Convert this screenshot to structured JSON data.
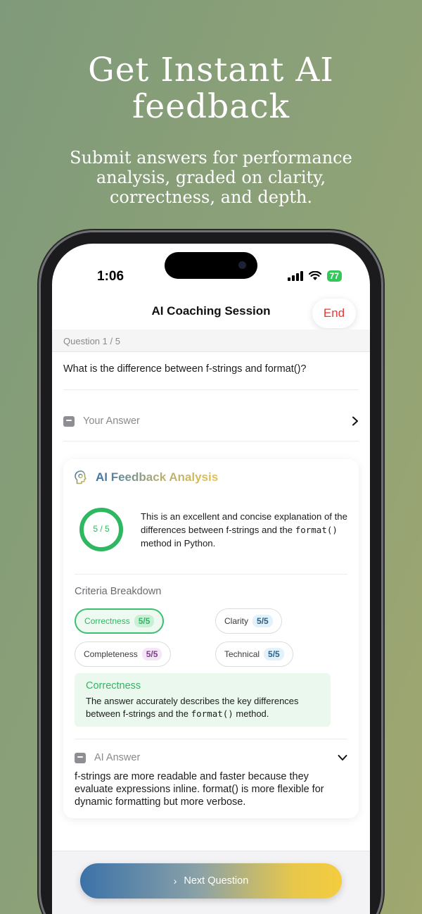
{
  "hero": {
    "title_line1": "Get Instant AI",
    "title_line2": "feedback",
    "subtitle": "Submit answers for performance analysis, graded on clarity, correctness, and depth."
  },
  "status_bar": {
    "time": "1:06",
    "battery": "77"
  },
  "header": {
    "title": "AI Coaching Session",
    "end_label": "End"
  },
  "progress": {
    "label": "Question 1 / 5",
    "current": 1,
    "total": 5
  },
  "question": {
    "text": "What is the difference between f-strings and format()?"
  },
  "your_answer": {
    "label": "Your Answer"
  },
  "feedback": {
    "title": "AI Feedback Analysis",
    "score_label": "5 / 5",
    "score": 5,
    "score_max": 5,
    "summary_pre": "This is an excellent and concise explanation of the differences between f-strings and the ",
    "summary_code": "format()",
    "summary_post": " method in Python.",
    "criteria_label": "Criteria Breakdown",
    "criteria": [
      {
        "name": "Correctness",
        "score": "5/5"
      },
      {
        "name": "Clarity",
        "score": "5/5"
      },
      {
        "name": "Completeness",
        "score": "5/5"
      },
      {
        "name": "Technical",
        "score": "5/5"
      }
    ],
    "detail": {
      "title": "Correctness",
      "text_pre": "The answer accurately describes the key differences between f-strings and the ",
      "text_code": "format()",
      "text_post": " method."
    },
    "ai_answer_label": "AI Answer",
    "ai_answer_text": "f-strings are more readable and faster because they evaluate expressions inline. format() is more flexible for dynamic formatting but more verbose."
  },
  "next_button": {
    "label": "Next Question"
  },
  "colors": {
    "success": "#2fb761",
    "danger": "#e53935",
    "gradient_start": "#3b72a9",
    "gradient_end": "#f4cc3e"
  }
}
